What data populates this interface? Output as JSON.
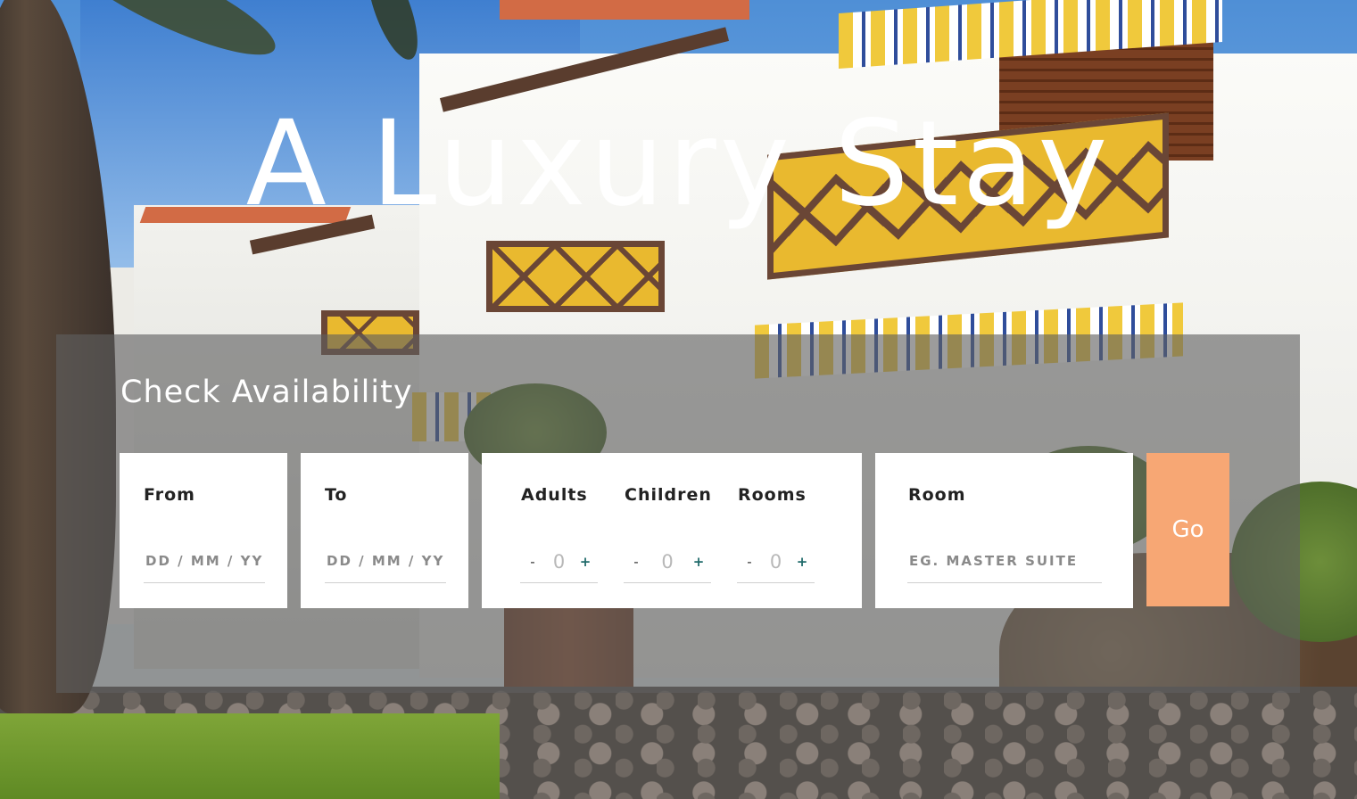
{
  "hero": {
    "title": "A Luxury Stay"
  },
  "availability": {
    "heading": "Check Availability",
    "from": {
      "label": "From",
      "placeholder": "DD / MM / YYYY"
    },
    "to": {
      "label": "To",
      "placeholder": "DD / MM / YYYY"
    },
    "adults": {
      "label": "Adults",
      "minus": "-",
      "value": "0",
      "plus": "+"
    },
    "children": {
      "label": "Children",
      "minus": "-",
      "value": "0",
      "plus": "+"
    },
    "rooms": {
      "label": "Rooms",
      "minus": "-",
      "value": "0",
      "plus": "+"
    },
    "room": {
      "label": "Room",
      "placeholder": "EG. MASTER SUITE"
    },
    "submit_label": "Go"
  },
  "colors": {
    "accent": "#f7a774",
    "panel_overlay": "#5f5f5f",
    "stepper_plus": "#1f6a6a"
  }
}
